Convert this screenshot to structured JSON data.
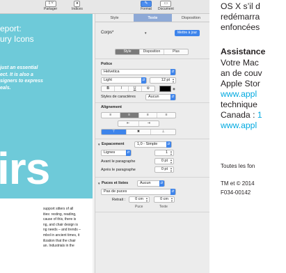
{
  "toolbar": {
    "share_label": "Partager",
    "share_icon": "share-icon",
    "tips_label": "Indices",
    "tips_icon": "lightbulb-icon"
  },
  "document": {
    "title_lines": [
      "eport:",
      "ury Icons"
    ],
    "quote_lines": [
      "just an essential",
      "ect. It is also a",
      "signers to express",
      "eals."
    ],
    "big_text": "irs",
    "body_lines": [
      "support sitters of all",
      "ities: resting, reading,",
      "cause of this, there is",
      "ng, and chair design is",
      "ng needs – and trends –",
      "mbol in ancient times, it",
      "ilization that the chair",
      "an. Industrials in the"
    ],
    "hero_color": "#6ecad9"
  },
  "inspector": {
    "top_tabs": [
      "Format",
      "Document"
    ],
    "tabs": [
      "Style",
      "Texte",
      "Disposition"
    ],
    "active_tab": "Texte",
    "paragraph_style": "Corps*",
    "update_button": "Mettre à jour",
    "subtabs": [
      "Style",
      "Disposition",
      "Plus"
    ],
    "active_subtab": "Style",
    "police_label": "Police",
    "font_name": "Helvetica",
    "font_weight": "Light",
    "font_size": "12 pt",
    "format_buttons": [
      "B",
      "I",
      "U",
      "⚙"
    ],
    "char_styles_label": "Styles de caractères",
    "char_styles_value": "Aucun",
    "alignment_label": "Alignement",
    "align_buttons": [
      "≡",
      "≡",
      "≡",
      "≡"
    ],
    "indent_buttons": [
      "⇤",
      "⇥"
    ],
    "valign_buttons": [
      "⊤",
      "✖",
      "⊥"
    ],
    "spacing_label": "Espacement",
    "spacing_value": "1,0 - Simple",
    "lines_label": "Lignes",
    "lines_value": "1",
    "before_label": "Avant le paragraphe",
    "before_value": "0 pt",
    "after_label": "Après le paragraphe",
    "after_value": "0 pt",
    "bullets_label": "Puces et listes",
    "bullets_value": "Aucun",
    "bullets_type": "Pas de puces",
    "retrait_label": "Retrait :",
    "retrait_puce": "0 cm",
    "retrait_texte": "0 cm",
    "puce_caption": "Puce",
    "texte_caption": "Texte",
    "accent_color": "#3d84eb",
    "tab_active_color": "#8ea9d6"
  },
  "right_page": {
    "lines": [
      "OS X s’il d",
      "redémarra",
      "enfoncées"
    ],
    "assist_title": "Assistance",
    "assist_lines": [
      "Votre Mac",
      "an de couv",
      "Apple Stor"
    ],
    "link1": "www.appl",
    "tech_line": "technique",
    "canada_prefix": "Canada : ",
    "canada_number": "1",
    "link2": "www.appl",
    "footer1": "Toutes les fon",
    "footer2": "TM et © 2014",
    "footer3": "F034-00142"
  }
}
